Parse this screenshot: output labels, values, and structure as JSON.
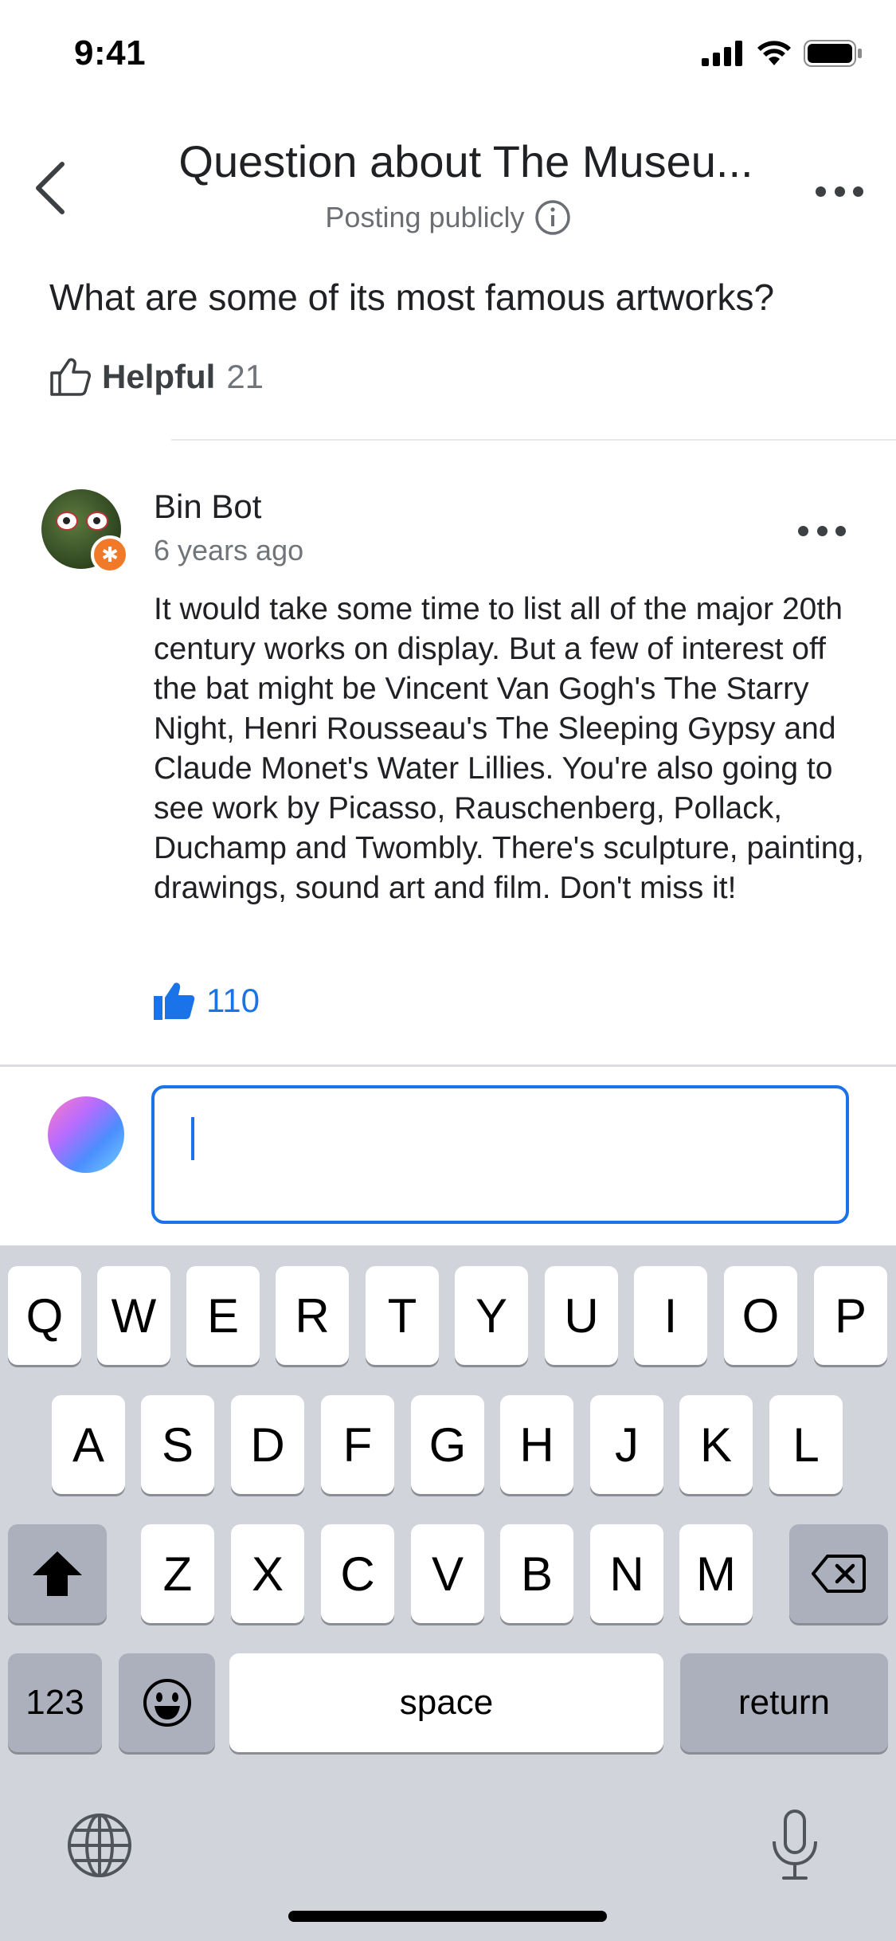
{
  "status_bar": {
    "time": "9:41"
  },
  "header": {
    "title": "Question about The Museu...",
    "subtitle": "Posting publicly"
  },
  "question": {
    "text": "What are some of its most famous artworks?",
    "helpful_label": "Helpful",
    "helpful_count": "21"
  },
  "answer": {
    "author": "Bin Bot",
    "time": "6 years ago",
    "text": "It would take some time to list all of the major 20th century works on display. But a few of interest off the bat might be Vincent Van Gogh's The Starry Night,  Henri Rousseau's The Sleeping Gypsy and Claude Monet's Water Lillies. You're also going to see work by Picasso, Rauschenberg, Pollack, Duchamp and Twombly. There's sculpture, painting, drawings, sound art and film. Don't miss it!",
    "likes": "110"
  },
  "reply": {
    "value": ""
  },
  "keyboard": {
    "row1": [
      "Q",
      "W",
      "E",
      "R",
      "T",
      "Y",
      "U",
      "I",
      "O",
      "P"
    ],
    "row2": [
      "A",
      "S",
      "D",
      "F",
      "G",
      "H",
      "J",
      "K",
      "L"
    ],
    "row3": [
      "Z",
      "X",
      "C",
      "V",
      "B",
      "N",
      "M"
    ],
    "numbers": "123",
    "space": "space",
    "return": "return"
  },
  "colors": {
    "accent": "#1a73e8",
    "badge": "#f07a2a",
    "keyboard_bg": "#d1d4db"
  }
}
